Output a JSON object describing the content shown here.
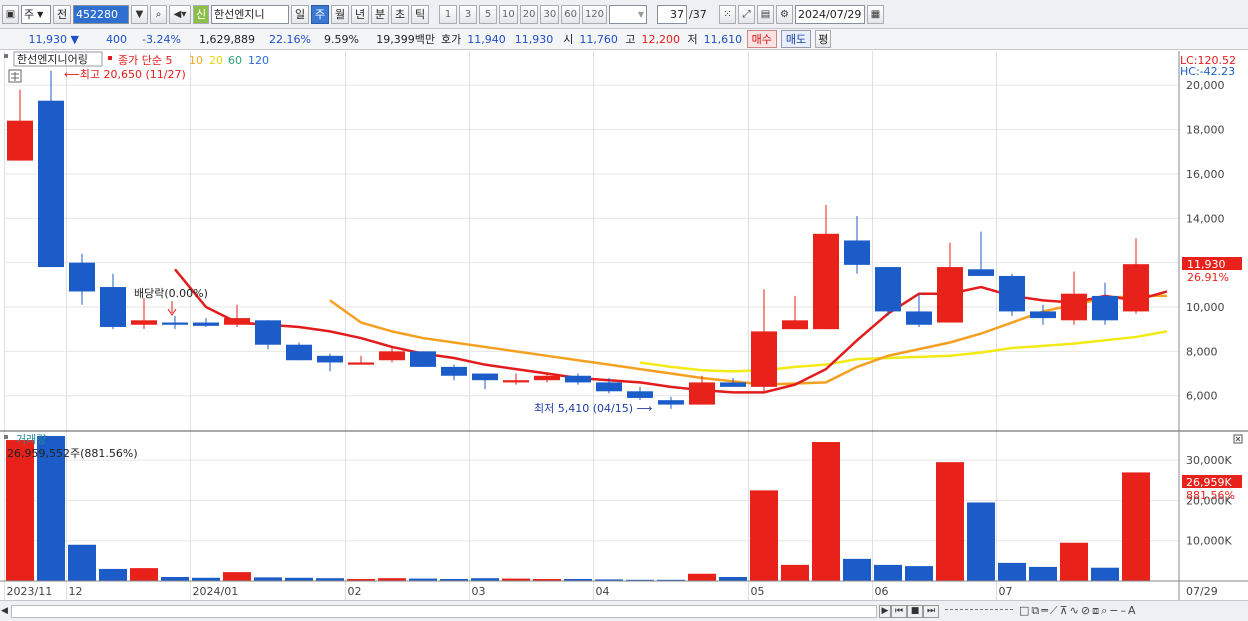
{
  "toolbar": {
    "period_type": "주",
    "prefix": "전",
    "code": "452280",
    "badge": "신",
    "name": "한선엔지니",
    "period_buttons": [
      "일",
      "주",
      "월",
      "년",
      "분",
      "초",
      "틱"
    ],
    "active_period": "주",
    "num_buttons": [
      "1",
      "3",
      "5",
      "10",
      "20",
      "30",
      "60",
      "120"
    ],
    "count": "37",
    "count_total": "/37",
    "date": "2024/07/29"
  },
  "quote": {
    "price": "11,930",
    "arrow": "▼",
    "change": "400",
    "change_pct": "-3.24%",
    "volume": "1,629,889",
    "rate1": "22.16%",
    "rate2": "9.59%",
    "amount": "19,399백만",
    "hoga_label": "호가",
    "bid": "11,940",
    "ask": "11,930",
    "open_label": "시",
    "open": "11,760",
    "high_label": "고",
    "high": "12,200",
    "low_label": "저",
    "low": "11,610",
    "buy_label": "매수",
    "sell_label": "매도",
    "avg_label": "평"
  },
  "legend": {
    "name": "한선엔지니어링",
    "ma_label": "종가 단순",
    "periods": [
      "5",
      "10",
      "20",
      "60",
      "120"
    ],
    "colors": [
      "#e21c1c",
      "#f5a623",
      "#e8d800",
      "#2aa47a",
      "#2a6fd8"
    ]
  },
  "info": {
    "lc": "LC:120.52",
    "hc": "HC:-42.23",
    "current_price": "11,930",
    "current_pct": "26.91%",
    "vol_label": "거래량",
    "vol_info": "26,959,552주(881.56%)",
    "vol_current": "26,959K",
    "vol_pct": "881.56%"
  },
  "annotations": {
    "max": "최고 20,650 (11/27)",
    "min": "최저 5,410 (04/15)",
    "dividend": "배당락(0.00%)"
  },
  "colors": {
    "up": "#e8211a",
    "down": "#1c5cc8",
    "ma5": "#e21c1c",
    "ma10": "#f5a020",
    "ma20": "#f2ea17"
  },
  "chart_data": {
    "type": "candlestick",
    "price_ylim": [
      4500,
      21000
    ],
    "price_ticks": [
      "20,000",
      "18,000",
      "16,000",
      "14,000",
      "12,000",
      "10,000",
      "8,000",
      "6,000"
    ],
    "price_tick_values": [
      20000,
      18000,
      16000,
      14000,
      12000,
      10000,
      8000,
      6000
    ],
    "volume_ticks": [
      "30,000K",
      "20,000K",
      "10,000K"
    ],
    "volume_tick_values": [
      30000,
      20000,
      10000
    ],
    "volume_ylim": [
      0,
      36000
    ],
    "x_labels": [
      {
        "i": 0,
        "text": "2023/11"
      },
      {
        "i": 2,
        "text": "12"
      },
      {
        "i": 6,
        "text": "2024/01"
      },
      {
        "i": 11,
        "text": "02"
      },
      {
        "i": 15,
        "text": "03"
      },
      {
        "i": 19,
        "text": "04"
      },
      {
        "i": 24,
        "text": "05"
      },
      {
        "i": 28,
        "text": "06"
      },
      {
        "i": 32,
        "text": "07"
      },
      {
        "i": 37,
        "text": "07/29"
      }
    ],
    "candles": [
      {
        "o": 16600,
        "h": 19800,
        "l": 16600,
        "c": 18400,
        "v": 35000
      },
      {
        "o": 19300,
        "h": 20650,
        "l": 11800,
        "c": 11800,
        "v": 36000
      },
      {
        "o": 12000,
        "h": 12400,
        "l": 10100,
        "c": 10700,
        "v": 9000
      },
      {
        "o": 10900,
        "h": 11500,
        "l": 9000,
        "c": 9100,
        "v": 3000
      },
      {
        "o": 9200,
        "h": 10400,
        "l": 9000,
        "c": 9400,
        "v": 3200
      },
      {
        "o": 9300,
        "h": 9600,
        "l": 9000,
        "c": 9200,
        "v": 1000
      },
      {
        "o": 9300,
        "h": 9500,
        "l": 9100,
        "c": 9150,
        "v": 800
      },
      {
        "o": 9200,
        "h": 10100,
        "l": 9100,
        "c": 9500,
        "v": 2200
      },
      {
        "o": 9400,
        "h": 9400,
        "l": 8100,
        "c": 8300,
        "v": 900
      },
      {
        "o": 8300,
        "h": 8400,
        "l": 7600,
        "c": 7600,
        "v": 800
      },
      {
        "o": 7800,
        "h": 7900,
        "l": 7100,
        "c": 7500,
        "v": 700
      },
      {
        "o": 7400,
        "h": 7800,
        "l": 7400,
        "c": 7500,
        "v": 500
      },
      {
        "o": 7600,
        "h": 8200,
        "l": 7500,
        "c": 8000,
        "v": 700
      },
      {
        "o": 8000,
        "h": 8000,
        "l": 7300,
        "c": 7300,
        "v": 600
      },
      {
        "o": 7300,
        "h": 7400,
        "l": 6700,
        "c": 6900,
        "v": 500
      },
      {
        "o": 7000,
        "h": 7000,
        "l": 6300,
        "c": 6700,
        "v": 700
      },
      {
        "o": 6600,
        "h": 7000,
        "l": 6500,
        "c": 6700,
        "v": 600
      },
      {
        "o": 6700,
        "h": 7000,
        "l": 6600,
        "c": 6900,
        "v": 500
      },
      {
        "o": 6900,
        "h": 7000,
        "l": 6500,
        "c": 6600,
        "v": 500
      },
      {
        "o": 6600,
        "h": 6800,
        "l": 6100,
        "c": 6200,
        "v": 400
      },
      {
        "o": 6200,
        "h": 6400,
        "l": 5800,
        "c": 5900,
        "v": 300
      },
      {
        "o": 5800,
        "h": 5950,
        "l": 5410,
        "c": 5600,
        "v": 300
      },
      {
        "o": 5600,
        "h": 6900,
        "l": 5600,
        "c": 6600,
        "v": 1800
      },
      {
        "o": 6600,
        "h": 6800,
        "l": 6400,
        "c": 6400,
        "v": 1000
      },
      {
        "o": 6400,
        "h": 10800,
        "l": 6200,
        "c": 8900,
        "v": 22500
      },
      {
        "o": 9000,
        "h": 10500,
        "l": 9000,
        "c": 9400,
        "v": 4000
      },
      {
        "o": 9000,
        "h": 14600,
        "l": 9000,
        "c": 13300,
        "v": 34500
      },
      {
        "o": 13000,
        "h": 14100,
        "l": 11500,
        "c": 11900,
        "v": 5500
      },
      {
        "o": 11800,
        "h": 11800,
        "l": 9600,
        "c": 9800,
        "v": 4000
      },
      {
        "o": 9800,
        "h": 10600,
        "l": 9100,
        "c": 9200,
        "v": 3700
      },
      {
        "o": 9300,
        "h": 12900,
        "l": 9300,
        "c": 11800,
        "v": 29500
      },
      {
        "o": 11700,
        "h": 13400,
        "l": 11400,
        "c": 11400,
        "v": 19500
      },
      {
        "o": 11400,
        "h": 11500,
        "l": 9600,
        "c": 9800,
        "v": 4500
      },
      {
        "o": 9800,
        "h": 10100,
        "l": 9200,
        "c": 9500,
        "v": 3500
      },
      {
        "o": 9400,
        "h": 11600,
        "l": 9200,
        "c": 10600,
        "v": 9500
      },
      {
        "o": 10500,
        "h": 11100,
        "l": 9200,
        "c": 9400,
        "v": 3300
      },
      {
        "o": 9800,
        "h": 13100,
        "l": 9700,
        "c": 11930,
        "v": 26959
      }
    ],
    "ma5": [
      null,
      null,
      null,
      null,
      11700,
      10000,
      9300,
      9200,
      9100,
      8900,
      8600,
      8200,
      7900,
      7700,
      7400,
      7200,
      7000,
      6800,
      6700,
      6600,
      6400,
      6250,
      6150,
      6150,
      6500,
      7200,
      8500,
      9700,
      10600,
      10600,
      10900,
      10500,
      10300,
      10200,
      10500,
      10300,
      10700
    ],
    "ma10": [
      null,
      null,
      null,
      null,
      null,
      null,
      null,
      null,
      null,
      10300,
      9300,
      8900,
      8600,
      8400,
      8200,
      8000,
      7800,
      7600,
      7400,
      7200,
      7000,
      6800,
      6650,
      6500,
      6550,
      6600,
      7300,
      7800,
      8100,
      8400,
      8800,
      9300,
      9800,
      10100,
      10400,
      10500,
      10500
    ],
    "ma20": [
      null,
      null,
      null,
      null,
      null,
      null,
      null,
      null,
      null,
      null,
      null,
      null,
      null,
      null,
      null,
      null,
      null,
      null,
      null,
      7500,
      7300,
      7150,
      7100,
      7150,
      7300,
      7400,
      7650,
      7700,
      7750,
      7800,
      7950,
      8150,
      8250,
      8350,
      8500,
      8650,
      8900
    ]
  }
}
